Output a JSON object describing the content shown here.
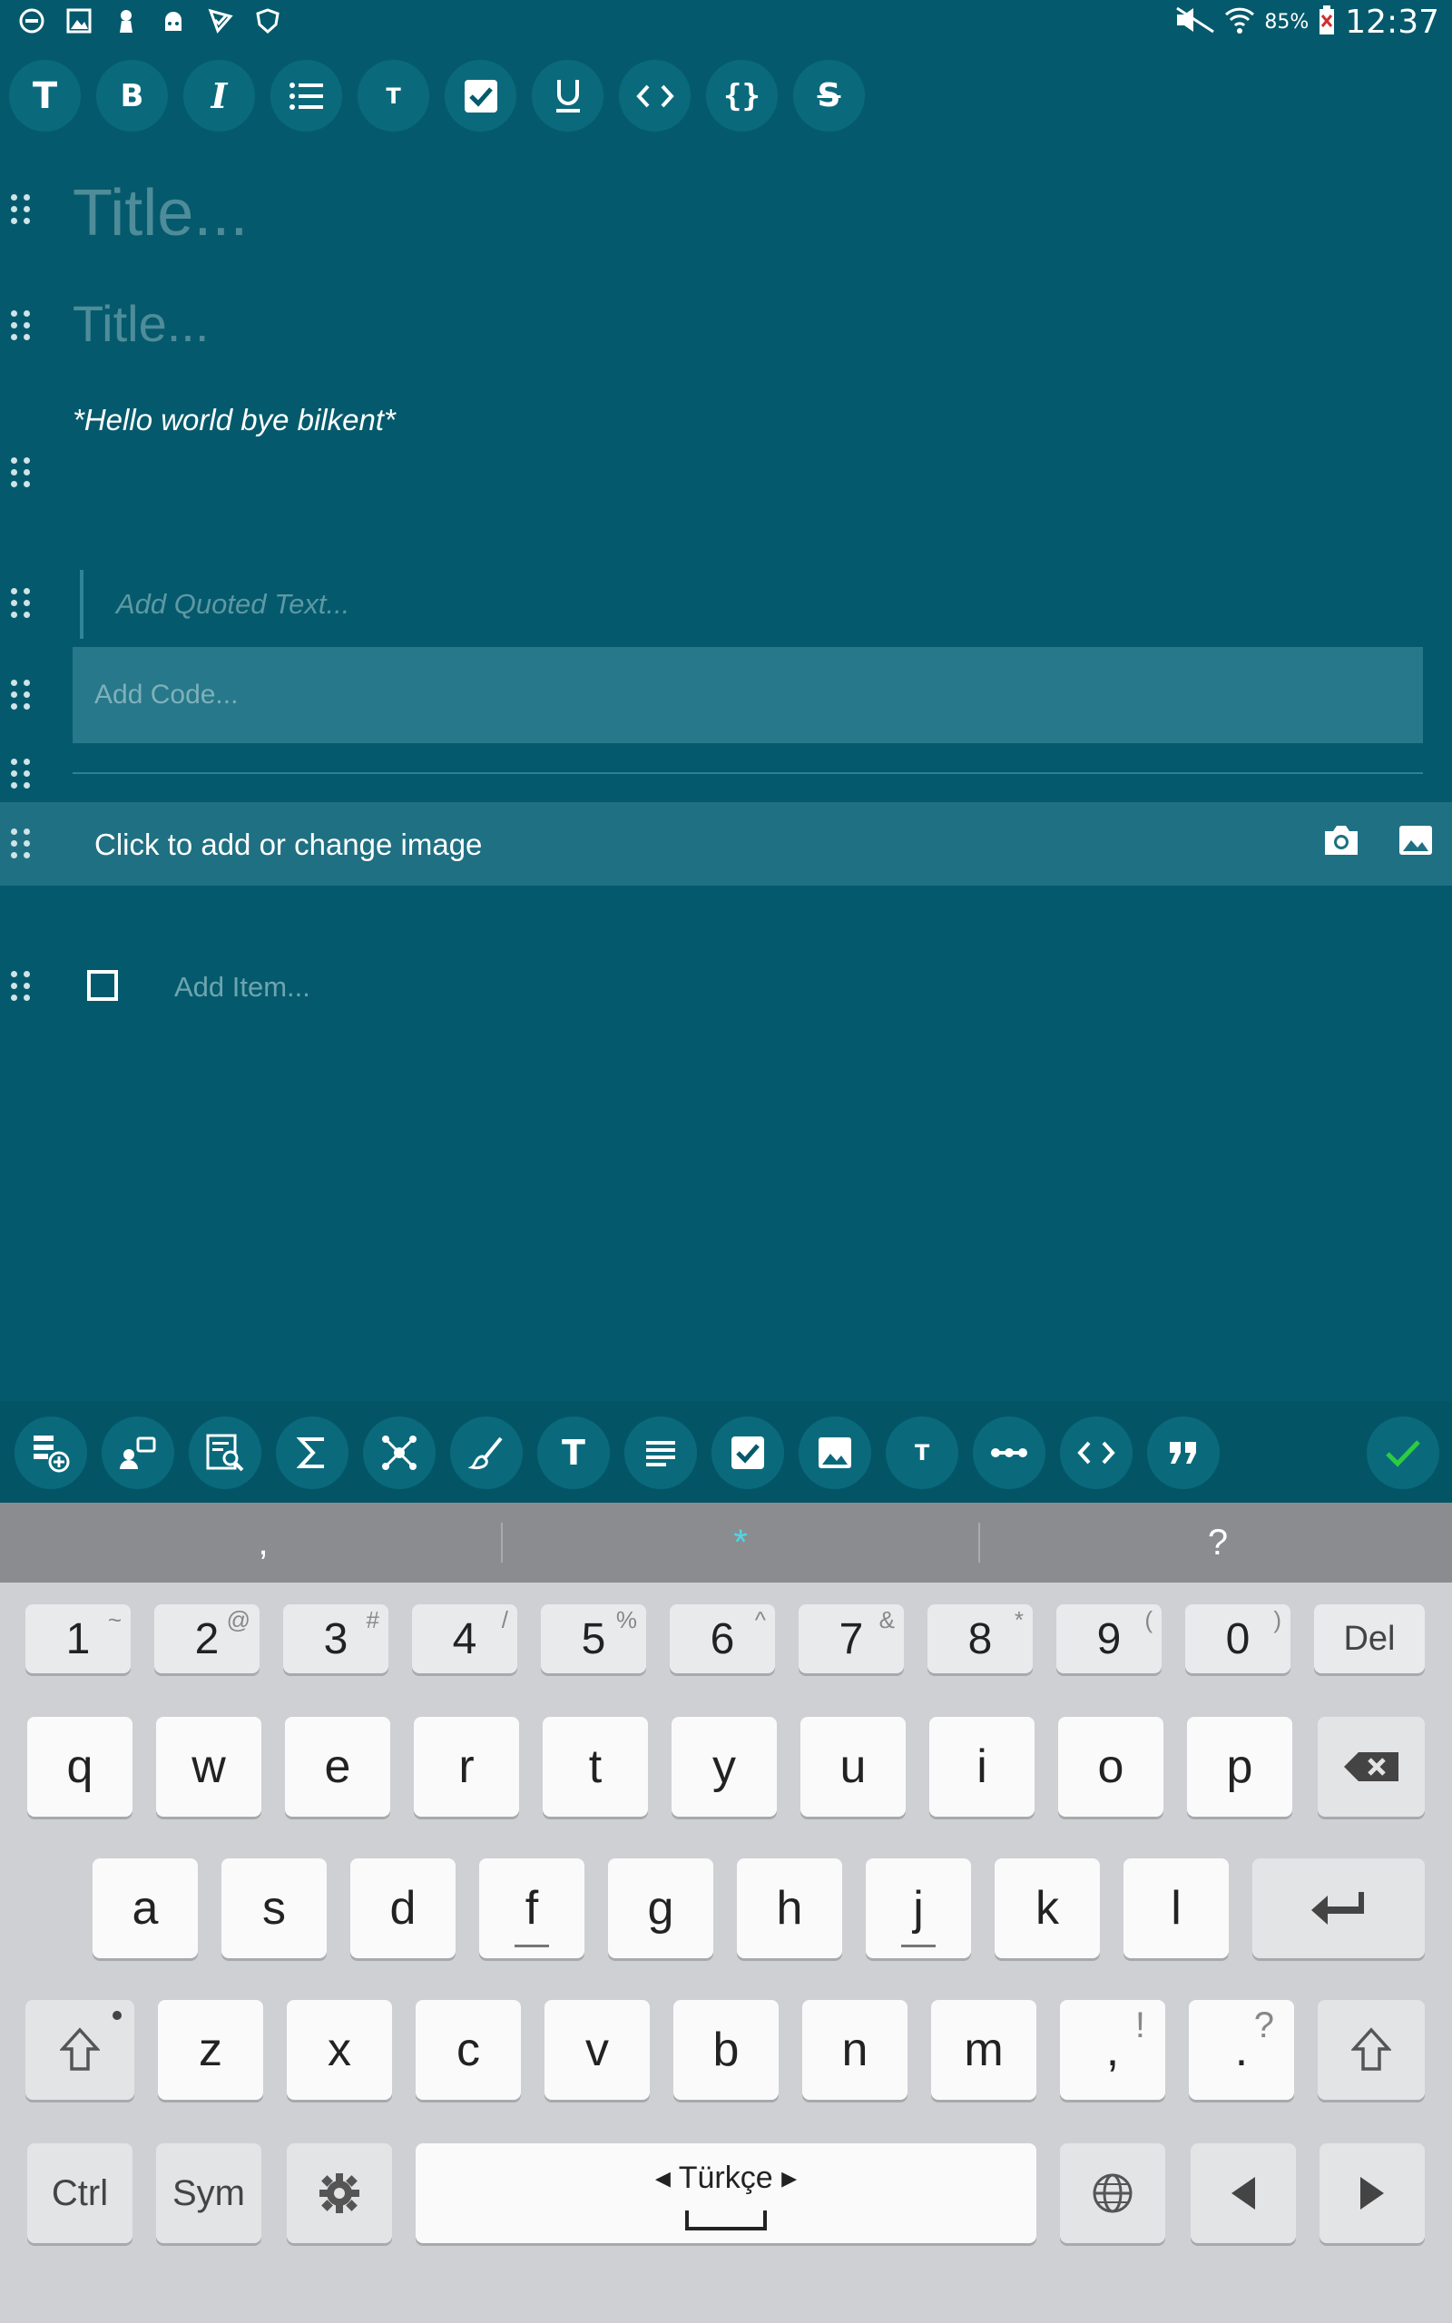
{
  "status_bar": {
    "battery": "85%",
    "time": "12:37",
    "left_icons": [
      "dnd-icon",
      "gallery-notif-icon",
      "location-icon",
      "android-icon",
      "checkmark-notif-icon",
      "shield-icon"
    ],
    "right_icons": [
      "mute-icon",
      "wifi-icon",
      "battery-icon"
    ]
  },
  "format_toolbar": {
    "buttons": [
      "T",
      "B",
      "I",
      "list",
      "T",
      "check",
      "U",
      "<>",
      "{}",
      "S"
    ]
  },
  "editor": {
    "title_large_placeholder": "Title...",
    "title_medium_placeholder": "Title...",
    "italic_text": "*Hello world bye bilkent*",
    "quote_placeholder": "Add Quoted Text...",
    "code_placeholder": "Add  Code...",
    "image_row_label": "Click to add or change image",
    "checklist_placeholder": "Add Item..."
  },
  "bottom_toolbar": {
    "buttons": [
      "add-note-icon",
      "assign-icon",
      "search-note-icon",
      "sigma-icon",
      "graph-icon",
      "brush-icon",
      "T",
      "paragraph-icon",
      "checkbox-icon",
      "image-icon",
      "T",
      "divider-icon",
      "<>",
      "quote-icon"
    ],
    "done_icon": "check-icon"
  },
  "keyboard": {
    "suggestions": [
      ",",
      "*",
      "?"
    ],
    "number_row": [
      {
        "k": "1",
        "s": "~"
      },
      {
        "k": "2",
        "s": "@"
      },
      {
        "k": "3",
        "s": "#"
      },
      {
        "k": "4",
        "s": "/"
      },
      {
        "k": "5",
        "s": "%"
      },
      {
        "k": "6",
        "s": "^"
      },
      {
        "k": "7",
        "s": "&"
      },
      {
        "k": "8",
        "s": "*"
      },
      {
        "k": "9",
        "s": "("
      },
      {
        "k": "0",
        "s": ")"
      }
    ],
    "del_label": "Del",
    "row1": [
      "q",
      "w",
      "e",
      "r",
      "t",
      "y",
      "u",
      "i",
      "o",
      "p"
    ],
    "row2": [
      "a",
      "s",
      "d",
      "f",
      "g",
      "h",
      "j",
      "k",
      "l"
    ],
    "row3": [
      "z",
      "x",
      "c",
      "v",
      "b",
      "n",
      "m"
    ],
    "comma_key": {
      "k": ",",
      "s": "!"
    },
    "period_key": {
      "k": ".",
      "s": "?"
    },
    "ctrl_label": "Ctrl",
    "sym_label": "Sym",
    "language": "Türkçe"
  }
}
